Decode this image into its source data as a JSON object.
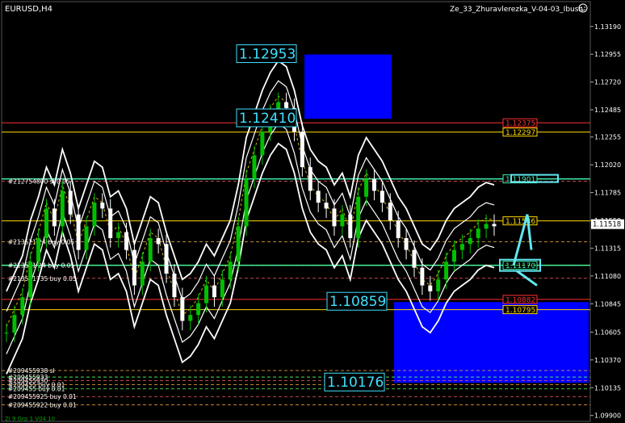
{
  "header": {
    "symbol": "EURUSD,H4",
    "indicator": "Ze_33_Zhuravlerezka_V-04-03_Ibush",
    "indicator_icon": "smiley-icon",
    "footer_indicator": "Zi 9 Grp 1 V04 10"
  },
  "colors": {
    "background": "#000000",
    "candle_bull": "#00c000",
    "candle_bear": "#ffffff",
    "zone": "#0000ff",
    "resistance": "#ff3030",
    "support": "#ffd700",
    "level_green": "#40f0b0",
    "big_label": "#40e0ff",
    "envelope": "#ffffff"
  },
  "chart_data": {
    "type": "candlestick",
    "symbol": "EURUSD",
    "timeframe": "H4",
    "ylim": [
      1.0985,
      1.134
    ],
    "y_ticks": [
      "1.13190",
      "1.12955",
      "1.12720",
      "1.12485",
      "1.12255",
      "1.12020",
      "1.11785",
      "1.11550",
      "1.11315",
      "1.11080",
      "1.10845",
      "1.10605",
      "1.10370",
      "1.10135",
      "1.09900"
    ],
    "current_price": "1.11518",
    "big_labels": [
      {
        "text": "1.12953",
        "price": 1.12953
      },
      {
        "text": "1.12410",
        "price": 1.1241
      },
      {
        "text": "1.10859",
        "price": 1.10859
      },
      {
        "text": "1.10176",
        "price": 1.10176
      }
    ],
    "price_levels": [
      {
        "text": "1.12375",
        "price": 1.12375,
        "kind": "resistance"
      },
      {
        "text": "1.12297",
        "price": 1.12297,
        "kind": "support"
      },
      {
        "text": "1.11901",
        "price": 1.11901,
        "kind": "green"
      },
      {
        "text": "1.11546",
        "price": 1.11546,
        "kind": "support"
      },
      {
        "text": "1.11170",
        "price": 1.1117,
        "kind": "green"
      },
      {
        "text": "1.10882",
        "price": 1.10882,
        "kind": "resistance"
      },
      {
        "text": "1.10795",
        "price": 1.10795,
        "kind": "support"
      }
    ],
    "order_labels": [
      {
        "text": "#212754800 sl 0.05",
        "price": 1.1188
      },
      {
        "text": "#213521 24 buy 0.05",
        "price": 1.1137
      },
      {
        "text": "#213521 24 buy 0.05",
        "price": 1.1117
      },
      {
        "text": "#213521735 buy 0.05",
        "price": 1.1106
      },
      {
        "text": "#209455938 sl",
        "price": 1.1028
      },
      {
        "text": "#209455933",
        "price": 1.10225
      },
      {
        "text": "#209455930",
        "price": 1.10195
      },
      {
        "text": "#209455 buy 0.01",
        "price": 1.1016
      },
      {
        "text": "#209455 buy 0.01",
        "price": 1.10125
      },
      {
        "text": "#209455925 buy 0.01",
        "price": 1.1006
      },
      {
        "text": "#209455922 buy 0.01",
        "price": 1.0999
      }
    ],
    "zones": [
      {
        "top": 1.12953,
        "bottom": 1.1241
      },
      {
        "top": 1.10859,
        "bottom": 1.10176
      }
    ],
    "candle_closes": [
      1.106,
      1.1075,
      1.109,
      1.112,
      1.114,
      1.1165,
      1.115,
      1.118,
      1.116,
      1.113,
      1.115,
      1.117,
      1.1165,
      1.114,
      1.1145,
      1.113,
      1.11,
      1.112,
      1.114,
      1.1135,
      1.111,
      1.109,
      1.107,
      1.1075,
      1.1085,
      1.11,
      1.109,
      1.1105,
      1.112,
      1.115,
      1.119,
      1.121,
      1.123,
      1.1245,
      1.1255,
      1.125,
      1.123,
      1.12,
      1.118,
      1.117,
      1.1165,
      1.115,
      1.116,
      1.114,
      1.1175,
      1.119,
      1.118,
      1.117,
      1.1155,
      1.114,
      1.113,
      1.1115,
      1.11,
      1.1095,
      1.1105,
      1.112,
      1.113,
      1.1135,
      1.114,
      1.1148,
      1.1152,
      1.115
    ]
  }
}
